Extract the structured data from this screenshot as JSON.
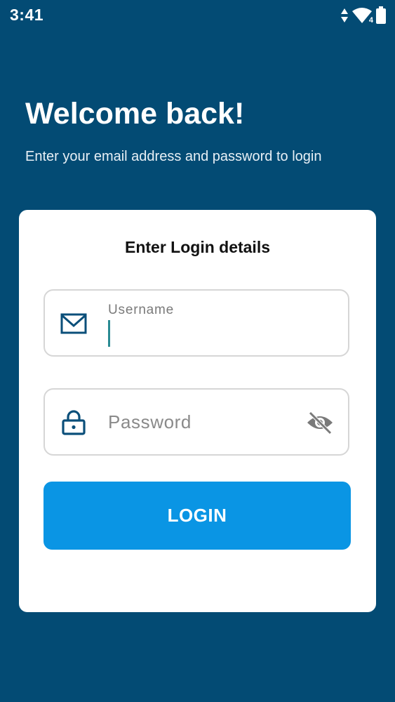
{
  "status_bar": {
    "time": "3:41",
    "icons": [
      "data-arrows-icon",
      "wifi-icon",
      "battery-icon"
    ],
    "wifi_badge": "4"
  },
  "header": {
    "title": "Welcome back!",
    "subtitle": "Enter your email address and password to login"
  },
  "card": {
    "title": "Enter Login details",
    "username": {
      "label": "Username",
      "value": "",
      "icon": "mail-icon"
    },
    "password": {
      "placeholder": "Password",
      "value": "",
      "icon": "lock-icon",
      "toggle_icon": "eye-off-icon"
    },
    "login_label": "LOGIN"
  },
  "colors": {
    "background": "#034b74",
    "card": "#ffffff",
    "accent": "#0a95e4",
    "icon": "#0b4f7a",
    "cursor": "#2a8b93"
  }
}
